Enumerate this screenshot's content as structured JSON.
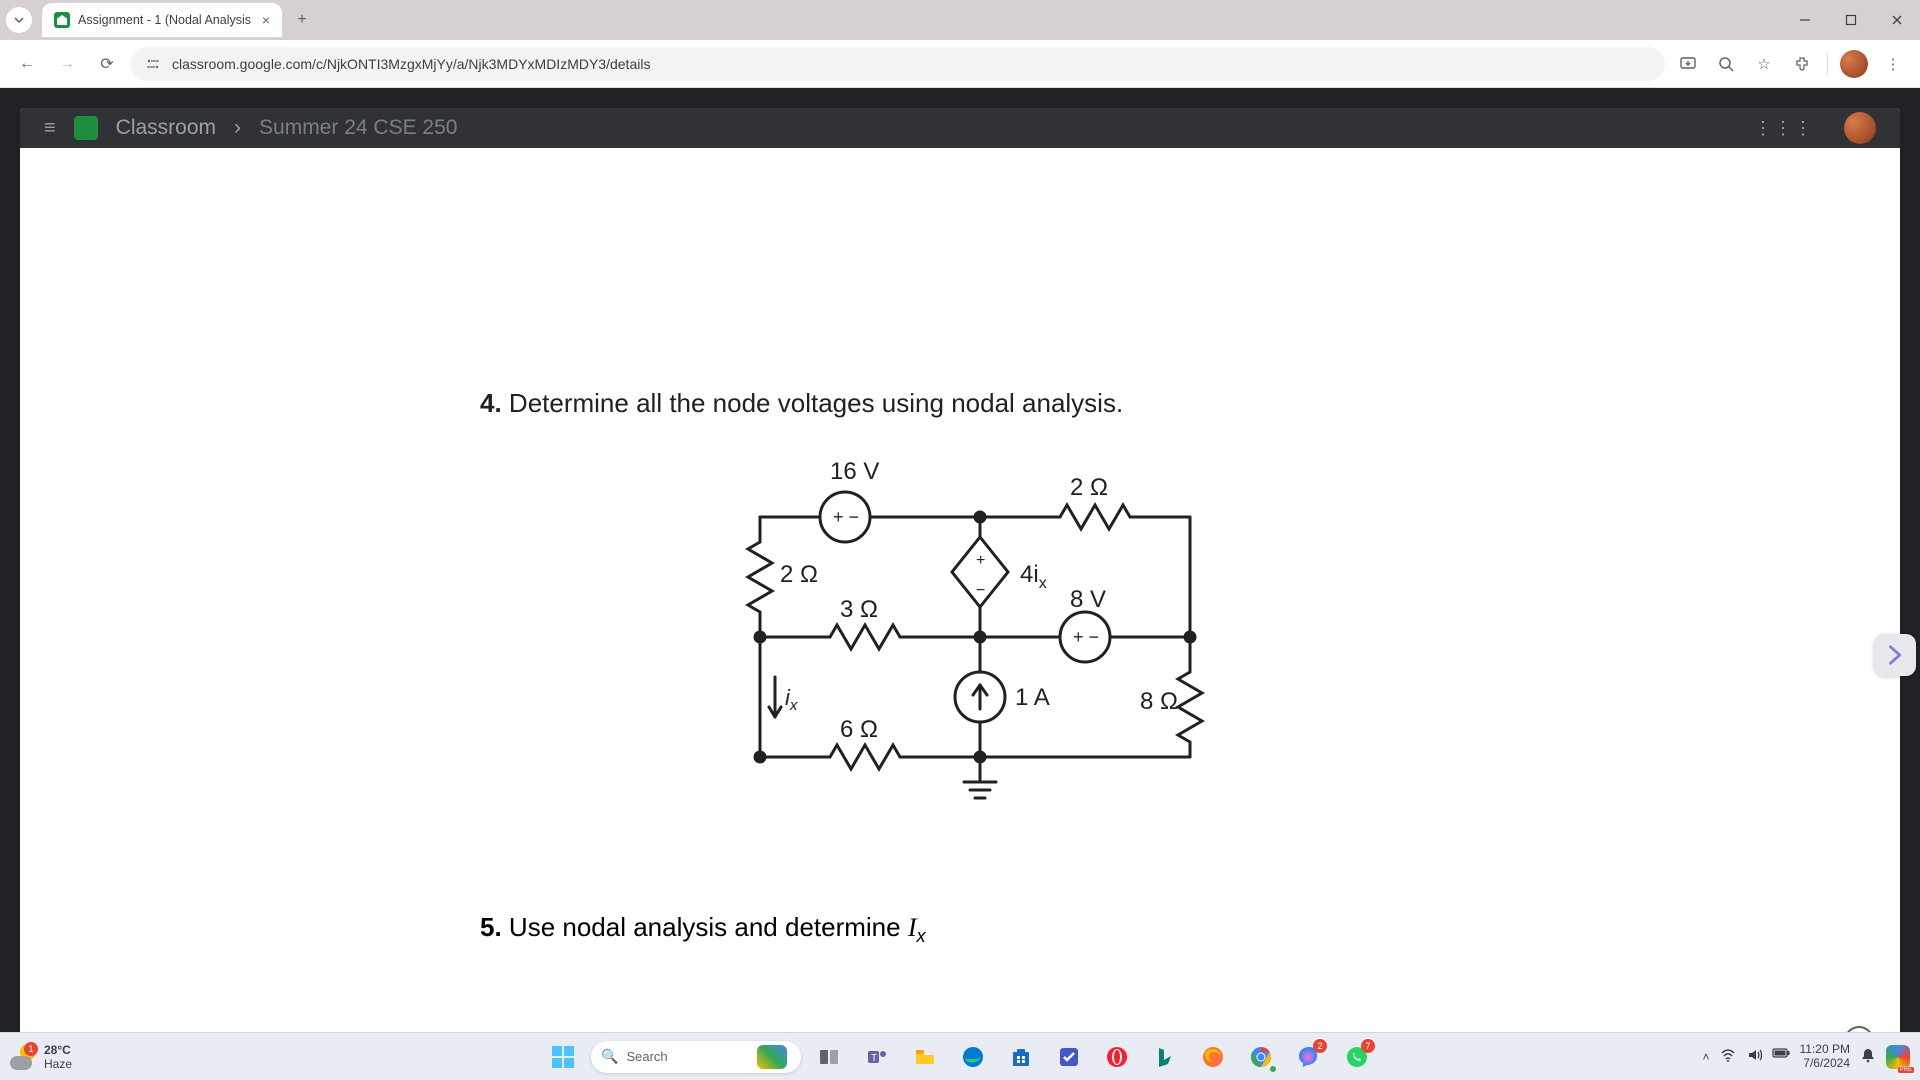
{
  "browser": {
    "tab_title": "Assignment - 1 (Nodal Analysis",
    "url": "classroom.google.com/c/NjkONTI3MzgxMjYy/a/Njk3MDYxMDIzMDY3/details"
  },
  "classroom_header": {
    "brand": "Classroom",
    "breadcrumb_sep": "›",
    "course": "Summer 24 CSE 250"
  },
  "questions": {
    "q4_num": "4.",
    "q4_text": "Determine all the node voltages using nodal analysis.",
    "q5_num": "5.",
    "q5_text_pre": "Use nodal analysis and determine ",
    "q5_var": "I",
    "q5_sub": "x"
  },
  "circuit": {
    "v_top": "16 V",
    "r_top_right": "2 Ω",
    "r_left": "2 Ω",
    "dep_src": "4i",
    "dep_sub": "x",
    "v_mid_right": "8 V",
    "r_mid_left": "3 Ω",
    "ix_label": "i",
    "ix_sub": "x",
    "i_src": "1 A",
    "r_right": "8 Ω",
    "r_bottom": "6 Ω"
  },
  "taskbar": {
    "weather_temp": "28°C",
    "weather_desc": "Haze",
    "weather_badge": "1",
    "search_placeholder": "Search",
    "time": "11:20 PM",
    "date": "7/6/2024",
    "msg_badge": "2",
    "wa_badge": "7"
  }
}
